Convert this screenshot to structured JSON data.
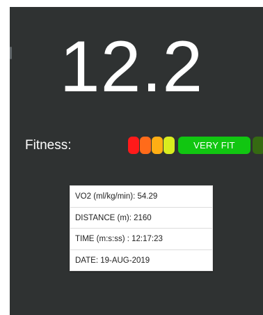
{
  "score": {
    "value": "12.2"
  },
  "fitness": {
    "label": "Fitness:",
    "segments": [
      {
        "color": "#ff1a1a"
      },
      {
        "color": "#ff6b1a"
      },
      {
        "color": "#ffae14"
      },
      {
        "color": "#d9ec1f"
      },
      {
        "color": "#11c611",
        "label": "VERY FIT"
      },
      {
        "color": "#356a12"
      }
    ]
  },
  "info": {
    "vo2": "VO2 (ml/kg/min): 54.29",
    "distance": "DISTANCE (m): 2160",
    "time": "TIME (m:s:ss) : 12:17:23",
    "date": "DATE: 19-AUG-2019"
  },
  "colors": {
    "background": "#2f3232",
    "card": "#ffffff",
    "text_primary": "#ffffff"
  },
  "icons": {
    "edge_mark": "edge-mark-icon"
  }
}
